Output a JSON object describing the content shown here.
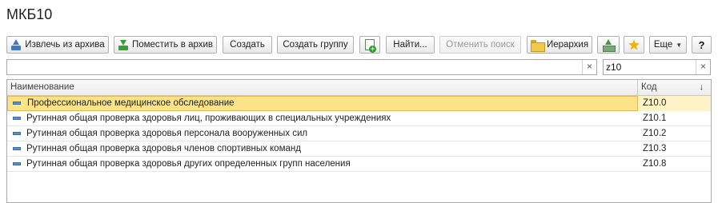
{
  "window": {
    "title": "МКБ10"
  },
  "toolbar": {
    "extract_label": "Извлечь из архива",
    "archive_label": "Поместить в архив",
    "create_label": "Создать",
    "create_group_label": "Создать группу",
    "find_label": "Найти...",
    "cancel_search_label": "Отменить поиск",
    "hierarchy_label": "Иерархия",
    "more_label": "Еще",
    "help_label": "?"
  },
  "search": {
    "main_value": "",
    "code_value": "z10",
    "clear_glyph": "×"
  },
  "table": {
    "columns": [
      "Наименование",
      "Код"
    ],
    "sort_indicator": "↓",
    "rows": [
      {
        "name": "Профессиональное медицинское обследование",
        "code": "Z10.0",
        "selected": true
      },
      {
        "name": "Рутинная общая проверка здоровья лиц, проживающих в специальных учреждениях",
        "code": "Z10.1",
        "selected": false
      },
      {
        "name": "Рутинная общая проверка здоровья персонала вооруженных сил",
        "code": "Z10.2",
        "selected": false
      },
      {
        "name": "Рутинная общая проверка здоровья членов спортивных команд",
        "code": "Z10.3",
        "selected": false
      },
      {
        "name": "Рутинная общая проверка здоровья других определенных групп населения",
        "code": "Z10.8",
        "selected": false
      }
    ]
  },
  "icons": {
    "extract": "archive-up-icon",
    "archive": "archive-down-icon",
    "copy": "new-document-icon",
    "hierarchy": "folder-hierarchy-icon",
    "export": "upload-tray-icon",
    "favorite": "star-icon",
    "more": "chevron-down-icon",
    "row_marker": "element-icon"
  },
  "colors": {
    "selection": "#fbe38a",
    "star": "#f2b400"
  }
}
